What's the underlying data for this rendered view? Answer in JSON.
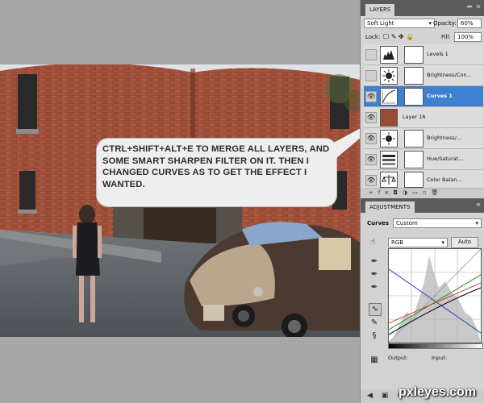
{
  "layers_panel": {
    "tab": "LAYERS",
    "blend_mode": "Soft Light",
    "opacity_label": "Opacity:",
    "opacity_value": "60%",
    "lock_label": "Lock:",
    "fill_label": "Fill:",
    "fill_value": "100%",
    "layers": [
      {
        "name": "Levels 1"
      },
      {
        "name": "Brightness/Con..."
      },
      {
        "name": "Curves 1"
      },
      {
        "name": "Layer 16"
      },
      {
        "name": "Brightness/..."
      },
      {
        "name": "Hue/Saturat..."
      },
      {
        "name": "Color Balan..."
      }
    ]
  },
  "adjustments_panel": {
    "tab": "ADJUSTMENTS",
    "title": "Curves",
    "preset": "Custom",
    "channel": "RGB",
    "auto_label": "Auto",
    "output_label": "Output:",
    "input_label": "Input:"
  },
  "callout": {
    "text": "CTRL+SHIFT+ALT+E TO MERGE ALL LAYERS, AND SOME SMART SHARPEN FILTER ON IT. THEN I CHANGED CURVES AS TO GET THE EFFECT I WANTED."
  },
  "watermark": "pxleyes.com",
  "colors": {
    "selection_blue": "#3d7fd0",
    "panel_gray": "#d4d4d4"
  }
}
